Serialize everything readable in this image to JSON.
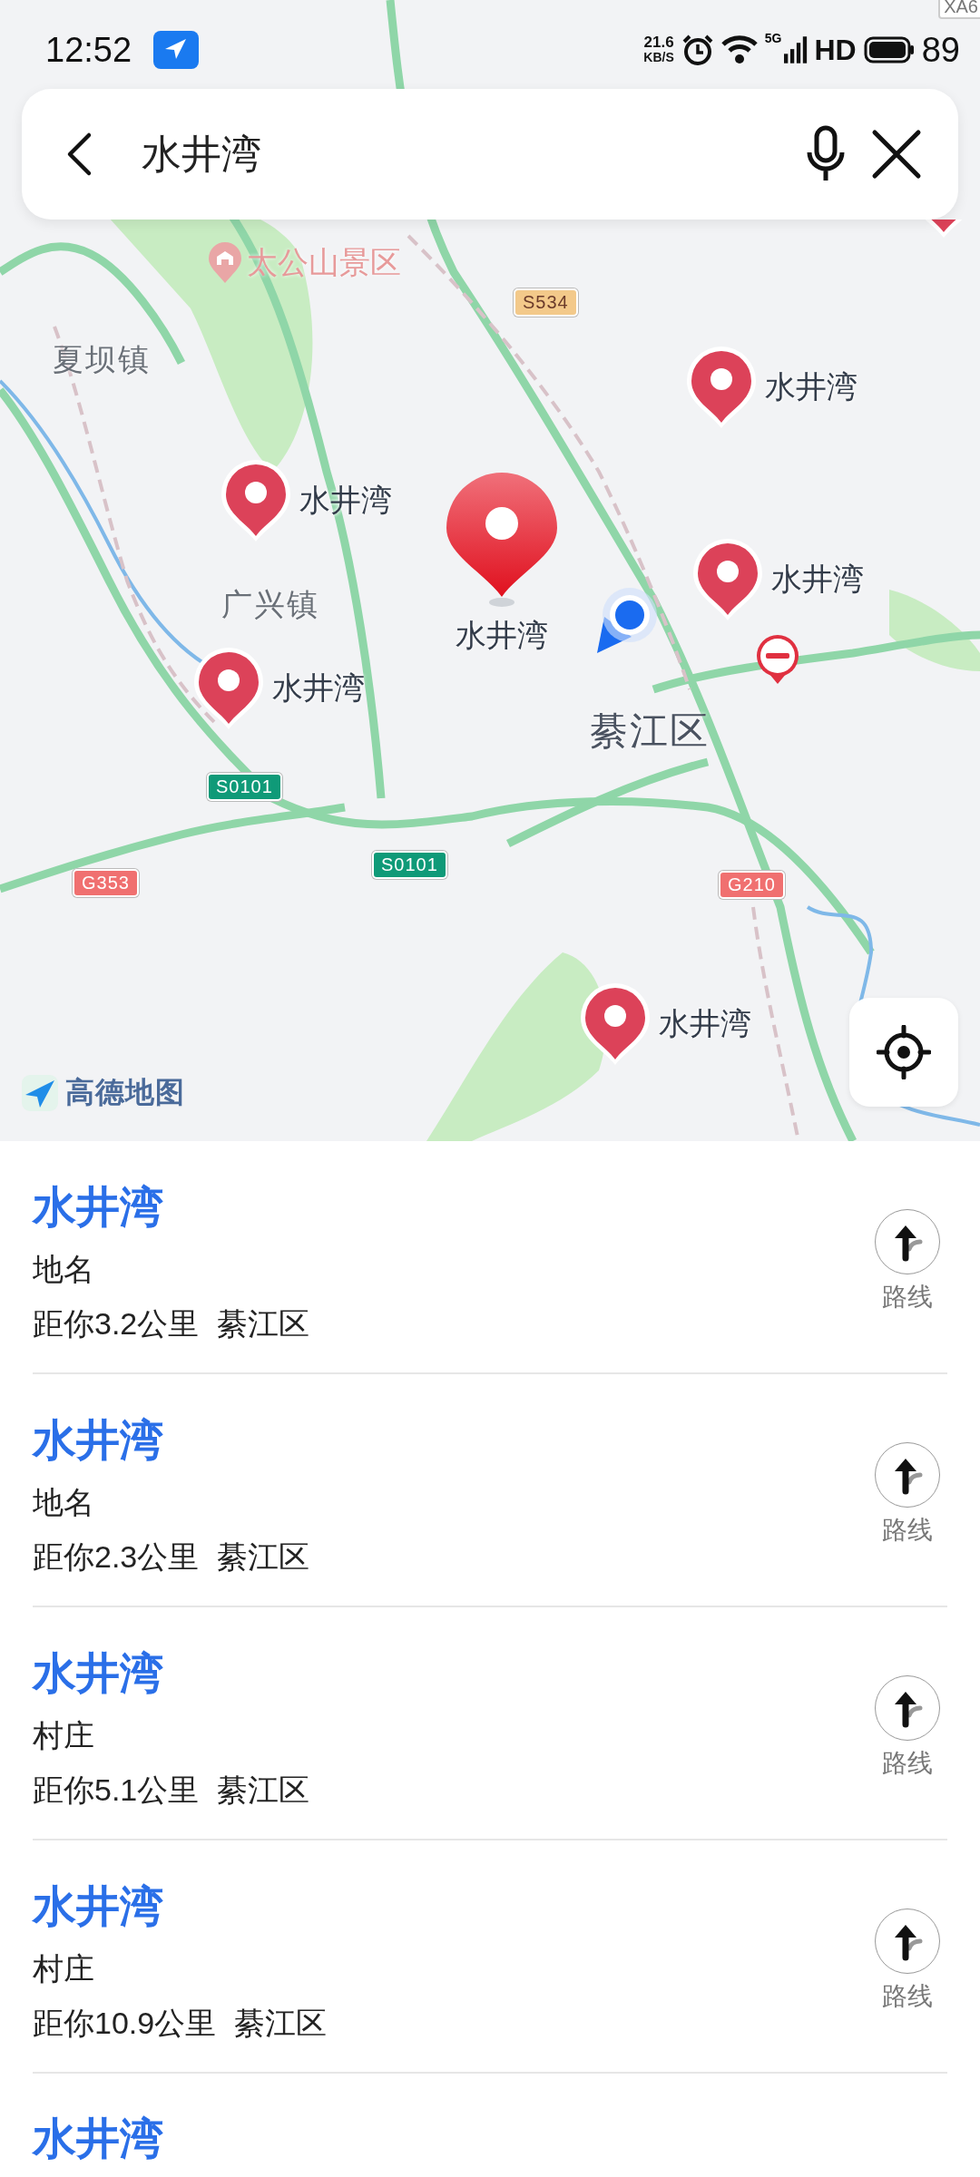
{
  "status_bar": {
    "time": "12:52",
    "speed_value": "21.6",
    "speed_unit": "KB/S",
    "network": "5G",
    "hd": "HD",
    "battery": "89"
  },
  "search": {
    "value": "水井湾"
  },
  "map": {
    "corner_text": "XA6",
    "place_labels": [
      {
        "kind": "scenic",
        "text": "太公山景区"
      },
      {
        "kind": "town",
        "text": "夏坝镇"
      },
      {
        "kind": "town",
        "text": "广兴镇"
      },
      {
        "kind": "district",
        "text": "綦江区"
      }
    ],
    "road_badges": [
      {
        "text": "S534",
        "color": "#f3c98a"
      },
      {
        "text": "S0101",
        "color": "#0f9a78"
      },
      {
        "text": "S0101",
        "color": "#0f9a78"
      },
      {
        "text": "G353",
        "color": "#f07070"
      },
      {
        "text": "G210",
        "color": "#f07070"
      }
    ],
    "pins": [
      {
        "selected": false
      },
      {
        "label": "水井湾",
        "selected": false
      },
      {
        "label": "水井湾",
        "selected": false
      },
      {
        "label": "水井湾",
        "selected": true
      },
      {
        "label": "水井湾",
        "selected": false
      },
      {
        "label": "水井湾",
        "selected": false
      },
      {
        "label": "水井湾",
        "selected": false
      }
    ],
    "logo_text": "高德地图"
  },
  "results": [
    {
      "title": "水井湾",
      "category": "地名",
      "distance": "距你3.2公里",
      "district": "綦江区",
      "route_label": "路线"
    },
    {
      "title": "水井湾",
      "category": "地名",
      "distance": "距你2.3公里",
      "district": "綦江区",
      "route_label": "路线"
    },
    {
      "title": "水井湾",
      "category": "村庄",
      "distance": "距你5.1公里",
      "district": "綦江区",
      "route_label": "路线"
    },
    {
      "title": "水井湾",
      "category": "村庄",
      "distance": "距你10.9公里",
      "district": "綦江区",
      "route_label": "路线"
    },
    {
      "title": "水井湾"
    }
  ]
}
